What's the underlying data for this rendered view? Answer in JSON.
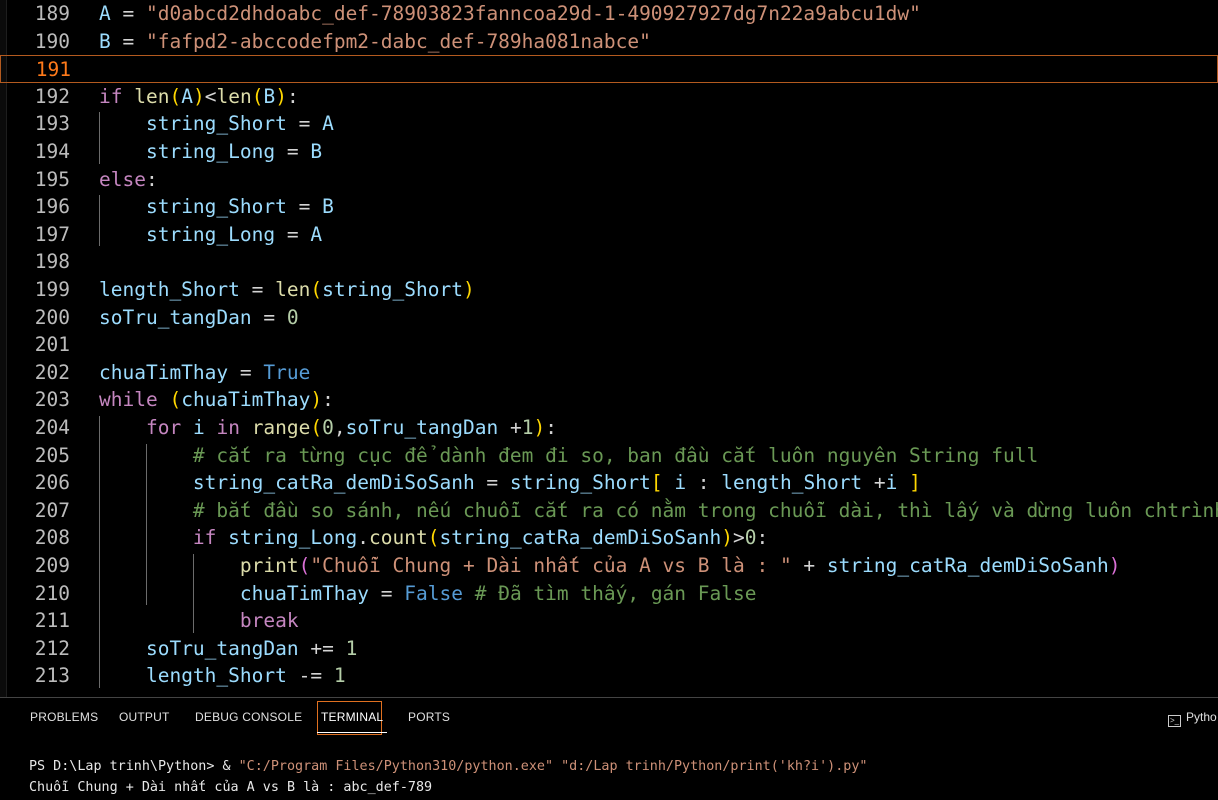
{
  "editor": {
    "lines": [
      {
        "n": "189",
        "segs": [
          [
            "v",
            "A"
          ],
          [
            "w",
            " = "
          ],
          [
            "s",
            "\"d0abcd2dhdoabc_def-78903823fanncoa29d-1-490927927dg7n22a9abcu1dw\""
          ]
        ]
      },
      {
        "n": "190",
        "segs": [
          [
            "v",
            "B"
          ],
          [
            "w",
            " = "
          ],
          [
            "s",
            "\"fafpd2-abccodefpm2-dabc_def-789ha081nabce\""
          ]
        ]
      },
      {
        "n": "191",
        "segs": []
      },
      {
        "n": "192",
        "segs": [
          [
            "k",
            "if"
          ],
          [
            "w",
            " "
          ],
          [
            "f",
            "len"
          ],
          [
            "y",
            "("
          ],
          [
            "v",
            "A"
          ],
          [
            "y",
            ")"
          ],
          [
            "w",
            "<"
          ],
          [
            "f",
            "len"
          ],
          [
            "y",
            "("
          ],
          [
            "v",
            "B"
          ],
          [
            "y",
            ")"
          ],
          [
            "w",
            ":"
          ]
        ]
      },
      {
        "n": "193",
        "segs": [
          [
            "w",
            "    "
          ],
          [
            "v",
            "string_Short"
          ],
          [
            "w",
            " = "
          ],
          [
            "v",
            "A"
          ]
        ]
      },
      {
        "n": "194",
        "segs": [
          [
            "w",
            "    "
          ],
          [
            "v",
            "string_Long"
          ],
          [
            "w",
            " = "
          ],
          [
            "v",
            "B"
          ]
        ]
      },
      {
        "n": "195",
        "segs": [
          [
            "k",
            "else"
          ],
          [
            "w",
            ":"
          ]
        ]
      },
      {
        "n": "196",
        "segs": [
          [
            "w",
            "    "
          ],
          [
            "v",
            "string_Short"
          ],
          [
            "w",
            " = "
          ],
          [
            "v",
            "B"
          ]
        ]
      },
      {
        "n": "197",
        "segs": [
          [
            "w",
            "    "
          ],
          [
            "v",
            "string_Long"
          ],
          [
            "w",
            " = "
          ],
          [
            "v",
            "A"
          ]
        ]
      },
      {
        "n": "198",
        "segs": []
      },
      {
        "n": "199",
        "segs": [
          [
            "v",
            "length_Short"
          ],
          [
            "w",
            " = "
          ],
          [
            "f",
            "len"
          ],
          [
            "y",
            "("
          ],
          [
            "v",
            "string_Short"
          ],
          [
            "y",
            ")"
          ]
        ]
      },
      {
        "n": "200",
        "segs": [
          [
            "v",
            "soTru_tangDan"
          ],
          [
            "w",
            " = "
          ],
          [
            "n",
            "0"
          ]
        ]
      },
      {
        "n": "201",
        "segs": []
      },
      {
        "n": "202",
        "segs": [
          [
            "v",
            "chuaTimThay"
          ],
          [
            "w",
            " = "
          ],
          [
            "b",
            "True"
          ]
        ]
      },
      {
        "n": "203",
        "segs": [
          [
            "k",
            "while"
          ],
          [
            "w",
            " "
          ],
          [
            "y",
            "("
          ],
          [
            "v",
            "chuaTimThay"
          ],
          [
            "y",
            ")"
          ],
          [
            "w",
            ":"
          ]
        ]
      },
      {
        "n": "204",
        "segs": [
          [
            "w",
            "    "
          ],
          [
            "k",
            "for"
          ],
          [
            "w",
            " "
          ],
          [
            "v",
            "i"
          ],
          [
            "w",
            " "
          ],
          [
            "k",
            "in"
          ],
          [
            "w",
            " "
          ],
          [
            "f",
            "range"
          ],
          [
            "y",
            "("
          ],
          [
            "n",
            "0"
          ],
          [
            "w",
            ","
          ],
          [
            "v",
            "soTru_tangDan"
          ],
          [
            "w",
            " +"
          ],
          [
            "n",
            "1"
          ],
          [
            "y",
            ")"
          ],
          [
            "w",
            ":"
          ]
        ]
      },
      {
        "n": "205",
        "segs": [
          [
            "w",
            "        "
          ],
          [
            "c",
            "# cắt ra từng cục để dành đem đi so, ban đầu cắt luôn nguyên String full"
          ]
        ]
      },
      {
        "n": "206",
        "segs": [
          [
            "w",
            "        "
          ],
          [
            "v",
            "string_catRa_demDiSoSanh"
          ],
          [
            "w",
            " = "
          ],
          [
            "v",
            "string_Short"
          ],
          [
            "y",
            "["
          ],
          [
            "w",
            " "
          ],
          [
            "v",
            "i"
          ],
          [
            "w",
            " : "
          ],
          [
            "v",
            "length_Short"
          ],
          [
            "w",
            " +"
          ],
          [
            "v",
            "i"
          ],
          [
            "w",
            " "
          ],
          [
            "y",
            "]"
          ]
        ]
      },
      {
        "n": "207",
        "segs": [
          [
            "w",
            "        "
          ],
          [
            "c",
            "# bắt đầu so sánh, nếu chuỗi cắt ra có nằm trong chuỗi dài, thì lấy và dừng luôn chtrình."
          ]
        ]
      },
      {
        "n": "208",
        "segs": [
          [
            "w",
            "        "
          ],
          [
            "k",
            "if"
          ],
          [
            "w",
            " "
          ],
          [
            "v",
            "string_Long"
          ],
          [
            "w",
            "."
          ],
          [
            "f",
            "count"
          ],
          [
            "y",
            "("
          ],
          [
            "v",
            "string_catRa_demDiSoSanh"
          ],
          [
            "y",
            ")"
          ],
          [
            "w",
            ">"
          ],
          [
            "n",
            "0"
          ],
          [
            "w",
            ":"
          ]
        ]
      },
      {
        "n": "209",
        "segs": [
          [
            "w",
            "            "
          ],
          [
            "f",
            "print"
          ],
          [
            "p",
            "("
          ],
          [
            "s",
            "\"Chuỗi Chung + Dài nhất của A vs B là : \""
          ],
          [
            "w",
            " + "
          ],
          [
            "v",
            "string_catRa_demDiSoSanh"
          ],
          [
            "p",
            ")"
          ]
        ]
      },
      {
        "n": "210",
        "segs": [
          [
            "w",
            "            "
          ],
          [
            "v",
            "chuaTimThay"
          ],
          [
            "w",
            " = "
          ],
          [
            "b",
            "False"
          ],
          [
            "w",
            " "
          ],
          [
            "c",
            "# Đã tìm thấy, gán False"
          ]
        ]
      },
      {
        "n": "211",
        "segs": [
          [
            "w",
            "            "
          ],
          [
            "k",
            "break"
          ]
        ]
      },
      {
        "n": "212",
        "segs": [
          [
            "w",
            "    "
          ],
          [
            "v",
            "soTru_tangDan"
          ],
          [
            "w",
            " += "
          ],
          [
            "n",
            "1"
          ]
        ]
      },
      {
        "n": "213",
        "segs": [
          [
            "w",
            "    "
          ],
          [
            "v",
            "length_Short"
          ],
          [
            "w",
            " -= "
          ],
          [
            "n",
            "1"
          ]
        ]
      }
    ]
  },
  "panel": {
    "tabs": [
      {
        "label": "PROBLEMS",
        "active": false
      },
      {
        "label": "OUTPUT",
        "active": false
      },
      {
        "label": "DEBUG CONSOLE",
        "active": false
      },
      {
        "label": "TERMINAL",
        "active": true
      },
      {
        "label": "PORTS",
        "active": false
      }
    ],
    "terminal_launch_label": "Pytho",
    "terminal": {
      "prompt": "PS D:\\Lap trinh\\Python> & ",
      "exe": "\"C:/Program Files/Python310/python.exe\"",
      "space": " ",
      "script": "\"d:/Lap trinh/Python/print('kh?i').py\"",
      "output": "Chuỗi Chung + Dài nhất của A vs B là : abc_def-789"
    }
  },
  "colors": {
    "keyword": "#c586c0",
    "variable": "#9cdcfe",
    "function": "#dcdcaa",
    "string": "#ce9178",
    "number": "#b5cea8",
    "builtin": "#569cd6",
    "comment": "#6a9955",
    "current_line_border": "#b35a1f"
  }
}
